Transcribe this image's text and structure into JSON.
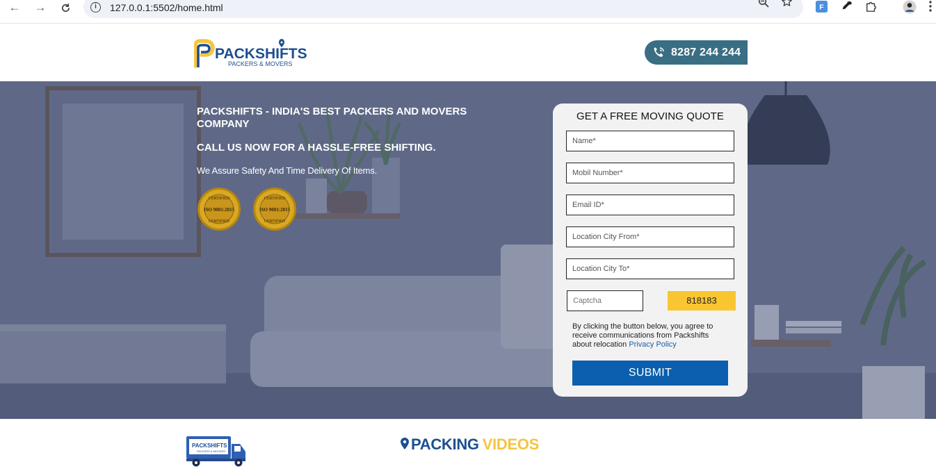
{
  "browser": {
    "url": "127.0.0.1:5502/home.html",
    "extension_badge": "F"
  },
  "header": {
    "logo": {
      "brand": "PACKSHIFTS",
      "tagline": "PACKERS & MOVERS"
    },
    "phone": "8287 244 244"
  },
  "hero": {
    "headline": "PACKSHIFTS - INDIA'S BEST PACKERS AND MOVERS COMPANY",
    "subheadline": "CALL US NOW FOR A HASSLE-FREE SHIFTING.",
    "tagline": "We Assure Safety And Time Delivery Of Items.",
    "badges": [
      {
        "top": "CERTIFIED",
        "mid": "ISO 9001:2015",
        "bottom": "CERTIFIED"
      },
      {
        "top": "CERTIFIED",
        "mid": "ISO 9001:2015",
        "bottom": "CERTIFIED"
      }
    ]
  },
  "quote_form": {
    "title": "GET A FREE MOVING QUOTE",
    "fields": {
      "name": "Name*",
      "mobile": "Mobil Number*",
      "email": "Email ID*",
      "city_from": "Location City From*",
      "city_to": "Location City To*",
      "captcha": "Captcha"
    },
    "captcha_code": "818183",
    "consent_text": "By clicking the button below, you agree to receive communications from Packshifts about relocation",
    "privacy_link": "Privacy Policy",
    "submit_label": "SUBMIT"
  },
  "section": {
    "truck_logo": {
      "brand": "PACKSHIFTS",
      "tagline": "PACKERS & MOVERS"
    },
    "title_part1": "PACKING",
    "title_part2": "VIDEOS"
  },
  "colors": {
    "brand_blue": "#1d4f91",
    "brand_yellow": "#f4c542",
    "submit_blue": "#0b5fae",
    "phone_pill": "#3a6e83",
    "captcha_yellow": "#f9c631"
  }
}
